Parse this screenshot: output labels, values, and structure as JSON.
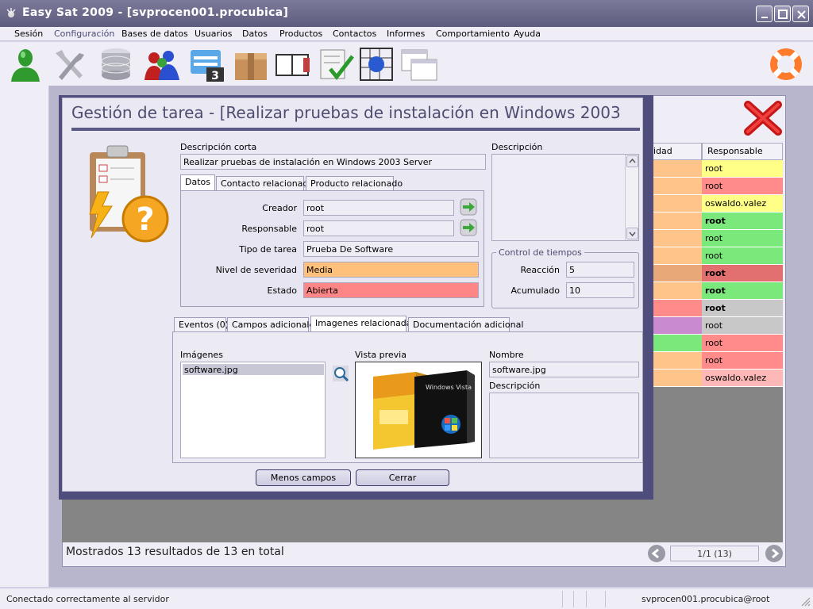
{
  "window": {
    "title": "Easy Sat 2009 - [svprocen001.procubica]"
  },
  "menu": [
    {
      "label": "Sesión"
    },
    {
      "label": "Configuración",
      "active": true
    },
    {
      "label": "Bases de datos"
    },
    {
      "label": "Usuarios"
    },
    {
      "label": "Datos"
    },
    {
      "label": "Productos"
    },
    {
      "label": "Contactos"
    },
    {
      "label": "Informes"
    },
    {
      "label": "Comportamiento"
    },
    {
      "label": "Ayuda"
    }
  ],
  "toolbar_icons": [
    "user-icon",
    "tools-icon",
    "database-icon",
    "users-group-icon",
    "calendar-icon",
    "box-icon",
    "agenda-icon",
    "checklist-icon",
    "network-icon",
    "windows-icon",
    "lifebuoy-icon"
  ],
  "grid": {
    "headers": [
      "idad",
      "Responsable"
    ],
    "rows": [
      {
        "left_color": "#ffc48a",
        "resp": "root",
        "resp_color": "#ffff88",
        "bold": false
      },
      {
        "left_color": "#ffc48a",
        "resp": "root",
        "resp_color": "#ff8b8b",
        "bold": false
      },
      {
        "left_color": "#ffc48a",
        "resp": "oswaldo.valez",
        "resp_color": "#ffff88",
        "bold": false
      },
      {
        "left_color": "#ffc48a",
        "resp": "root",
        "resp_color": "#7be87b",
        "bold": true
      },
      {
        "left_color": "#ffc48a",
        "resp": "root",
        "resp_color": "#7be87b",
        "bold": false
      },
      {
        "left_color": "#ffc48a",
        "resp": "root",
        "resp_color": "#7be87b",
        "bold": false
      },
      {
        "left_color": "#e8a878",
        "resp": "root",
        "resp_color": "#e27070",
        "bold": true
      },
      {
        "left_color": "#ffc48a",
        "resp": "root",
        "resp_color": "#7be87b",
        "bold": true
      },
      {
        "left_color": "#ff8b8b",
        "resp": "root",
        "resp_color": "#c8c8c8",
        "bold": true
      },
      {
        "left_color": "#c98ad0",
        "resp": "root",
        "resp_color": "#c8c8c8",
        "bold": false
      },
      {
        "left_color": "#7be87b",
        "resp": "root",
        "resp_color": "#ff8b8b",
        "bold": false
      },
      {
        "left_color": "#ffc48a",
        "resp": "root",
        "resp_color": "#ff8b8b",
        "bold": false
      },
      {
        "left_color": "#ffc48a",
        "resp": "oswaldo.valez",
        "resp_color": "#ffb8b8",
        "bold": false
      }
    ]
  },
  "results_text": "Mostrados 13 resultados de 13 en total",
  "pager_text": "1/1 (13)",
  "dialog": {
    "title": "Gestión de tarea - [Realizar pruebas de instalación en Windows 2003",
    "short_desc_label": "Descripción corta",
    "short_desc_value": "Realizar pruebas de instalación en Windows 2003 Server",
    "description_label": "Descripción",
    "tabs_top": [
      "Datos",
      "Contacto relacionado",
      "Producto relacionado"
    ],
    "fields": {
      "creador_label": "Creador",
      "creador_value": "root",
      "responsable_label": "Responsable",
      "responsable_value": "root",
      "tipo_label": "Tipo de tarea",
      "tipo_value": "Prueba De Software",
      "nivel_label": "Nivel de severidad",
      "nivel_value": "Media",
      "nivel_color": "#ffc07c",
      "estado_label": "Estado",
      "estado_value": "Abierta",
      "estado_color": "#ff8686"
    },
    "control": {
      "legend": "Control de tiempos",
      "reaccion_label": "Reacción",
      "reaccion_value": "5",
      "acumulado_label": "Acumulado",
      "acumulado_value": "10"
    },
    "tabs_bottom": [
      "Eventos (0)",
      "Campos adicionales",
      "Imagenes relacionadas",
      "Documentación adicional"
    ],
    "images_label": "Imágenes",
    "images": [
      "software.jpg"
    ],
    "preview_label": "Vista previa",
    "nombre_label": "Nombre",
    "nombre_value": "software.jpg",
    "desc2_label": "Descripción",
    "btn_menos": "Menos campos",
    "btn_cerrar": "Cerrar"
  },
  "status": {
    "left": "Conectado correctamente al servidor",
    "right": "svprocen001.procubica@root"
  }
}
